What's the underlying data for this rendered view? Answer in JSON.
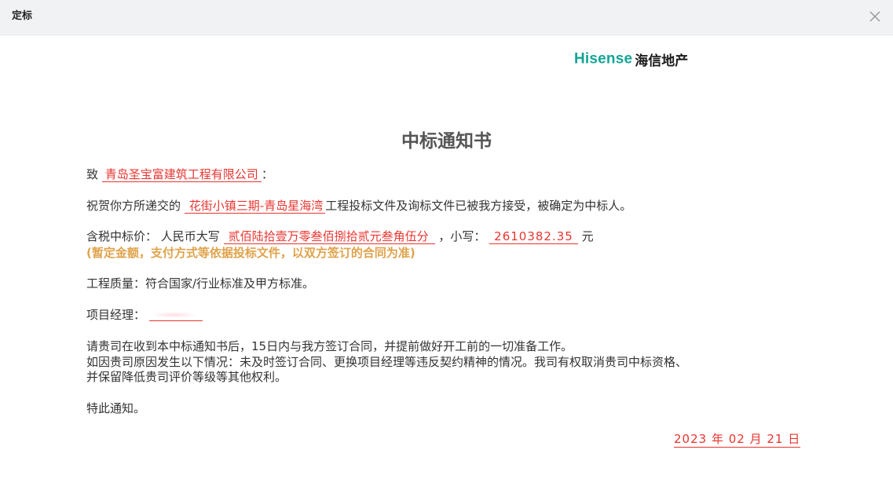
{
  "dialog": {
    "title": "定标"
  },
  "logo": {
    "brand_en": "Hisense",
    "brand_cn": "海信地产",
    "brand_color": "#13a596"
  },
  "notice": {
    "title": "中标通知书",
    "to_prefix": "致",
    "to_company": "青岛圣宝富建筑工程有限公司",
    "to_suffix": "：",
    "congrats_prefix": "祝贺你方所递交的",
    "project_name": "花街小镇三期-青岛星海湾",
    "congrats_suffix": "工程投标文件及询标文件已被我方接受，被确定为中标人。",
    "price_label": "含税中标价：  人民币大写",
    "price_uppercase": "贰佰陆拾壹万零叁佰捌拾贰元叁角伍分",
    "price_small_label": "，小写：",
    "price_number": "2610382.35",
    "price_unit": "元",
    "price_note": "(暂定金额，支付方式等依据投标文件，以双方签订的合同为准)",
    "quality": "工程质量：符合国家/行业标准及甲方标准。",
    "manager_label": "项目经理：",
    "request_line": "请贵司在收到本中标通知书后，15日内与我方签订合同，并提前做好开工前的一切准备工作。",
    "warning_line1": "如因贵司原因发生以下情况：未及时签订合同、更换项目经理等违反契约精神的情况。我司有权取消贵司中标资格、",
    "warning_line2": "并保留降低贵司评价等级等其他权利。",
    "closing": "特此通知。",
    "date": "2023 年 02 月 21 日"
  },
  "colors": {
    "highlight_red": "#e8352f",
    "note_orange": "#e0a24a",
    "header_bg": "#f1f2f4"
  },
  "icons": {
    "close": "close-icon"
  }
}
